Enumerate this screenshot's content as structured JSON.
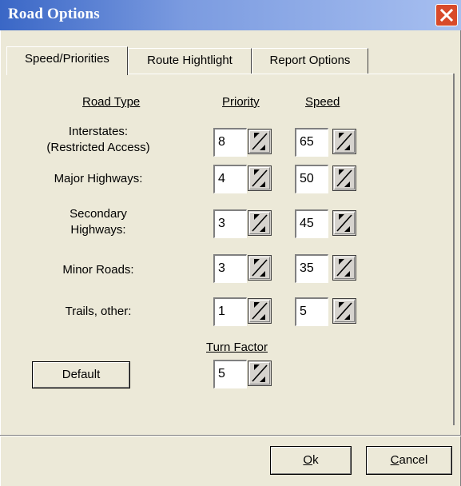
{
  "window": {
    "title": "Road Options"
  },
  "tabs": [
    {
      "label": "Speed/Priorities",
      "active": true
    },
    {
      "label": "Route Hightlight",
      "active": false
    },
    {
      "label": "Report Options",
      "active": false
    }
  ],
  "headers": {
    "road_type": "Road Type",
    "priority": "Priority",
    "speed": "Speed"
  },
  "rows": [
    {
      "label": "Interstates:\n(Restricted Access)",
      "priority": "8",
      "speed": "65"
    },
    {
      "label": "Major Highways:",
      "priority": "4",
      "speed": "50"
    },
    {
      "label": "Secondary\nHighways:",
      "priority": "3",
      "speed": "45"
    },
    {
      "label": "Minor Roads:",
      "priority": "3",
      "speed": "35"
    },
    {
      "label": "Trails, other:",
      "priority": "1",
      "speed": "5"
    }
  ],
  "turn_factor": {
    "label": "Turn Factor",
    "value": "5"
  },
  "buttons": {
    "default": "Default",
    "ok": "Ok",
    "ok_mnemonic": "O",
    "ok_rest": "k",
    "cancel_mnemonic": "C",
    "cancel_rest": "ancel"
  },
  "colors": {
    "titlebar_start": "#3a67c6",
    "titlebar_end": "#a7bff0",
    "dialog_bg": "#ece9d8",
    "close_button": "#d84a2a"
  }
}
